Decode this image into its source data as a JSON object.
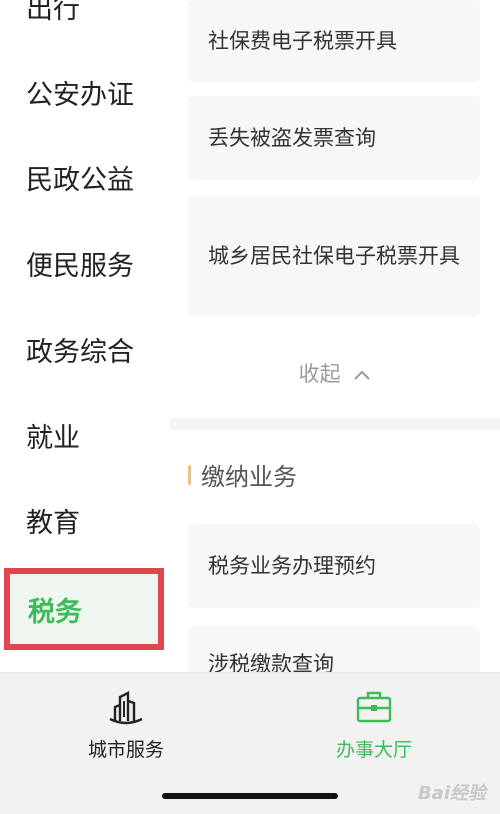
{
  "sidebar": {
    "items": [
      {
        "label": "出行"
      },
      {
        "label": "公安办证"
      },
      {
        "label": "民政公益"
      },
      {
        "label": "便民服务"
      },
      {
        "label": "政务综合"
      },
      {
        "label": "就业"
      },
      {
        "label": "教育"
      }
    ],
    "active_label": "税务"
  },
  "main": {
    "cards_top": [
      {
        "label": "社保费电子税票开具"
      },
      {
        "label": "丢失被盗发票查询"
      },
      {
        "label": "城乡居民社保电子税票开具"
      }
    ],
    "collapse_label": "收起",
    "section_title": "缴纳业务",
    "cards_section": [
      {
        "label": "税务业务办理预约"
      },
      {
        "label": "涉税缴款查询"
      }
    ]
  },
  "tabbar": {
    "tabs": [
      {
        "label": "城市服务",
        "icon": "buildings-icon"
      },
      {
        "label": "办事大厅",
        "icon": "briefcase-icon"
      }
    ],
    "active_color": "#3dbb58"
  },
  "watermark": "Bai经验"
}
